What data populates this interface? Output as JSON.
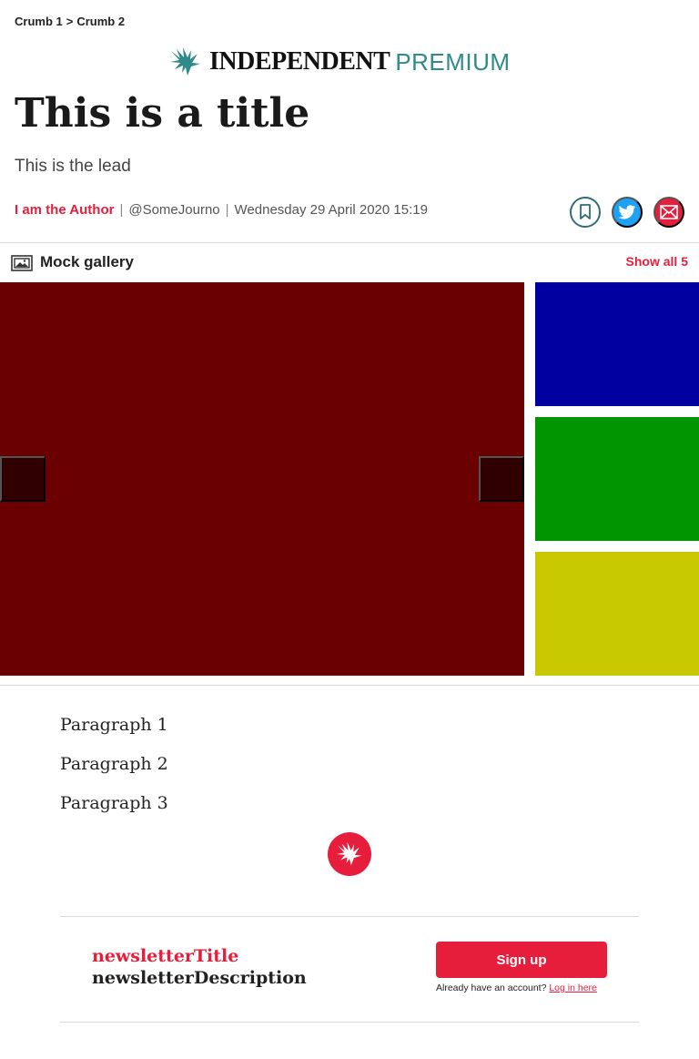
{
  "breadcrumb": {
    "items": [
      "Crumb 1",
      "Crumb 2"
    ],
    "separator": ">"
  },
  "masthead": {
    "brand": "INDEPENDENT",
    "premium": "PREMIUM"
  },
  "article": {
    "title": "This is a title",
    "lead": "This is the lead",
    "author": "I am the Author",
    "handle": "@SomeJourno",
    "date": "Wednesday 29 April 2020 15:19",
    "paragraphs": [
      "Paragraph 1",
      "Paragraph 2",
      "Paragraph 3"
    ]
  },
  "share": {
    "icons": [
      "bookmark-icon",
      "twitter-icon",
      "email-icon"
    ]
  },
  "gallery": {
    "title": "Mock gallery",
    "show_all": "Show all 5",
    "main_color": "#6b0000",
    "thumb_colors": [
      "#0000a0",
      "#009400",
      "#c8c800"
    ]
  },
  "newsletter": {
    "title": "newsletterTitle",
    "description": "newsletterDescription",
    "signup_label": "Sign up",
    "account_text": "Already have an account?",
    "login_label": "Log in here"
  },
  "colors": {
    "accent": "#e61e3c",
    "premium": "#2f8a8a",
    "twitter": "#1da1f2"
  }
}
